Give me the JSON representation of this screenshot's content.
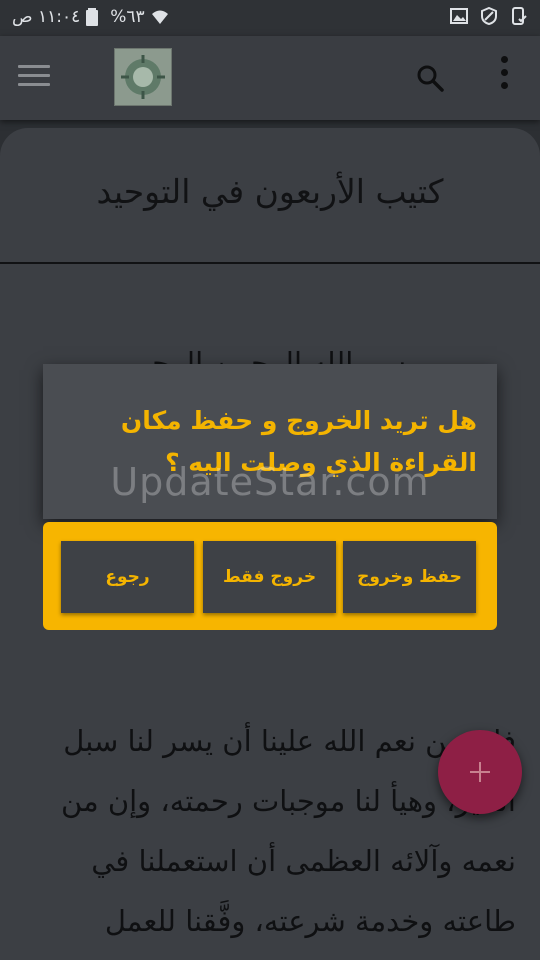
{
  "status_bar": {
    "time": "١١:٠٤ ص",
    "battery": "%٦٣"
  },
  "app_bar": {
    "logo_icon": "book-logo-icon",
    "search_icon": "search-icon",
    "menu_icon": "hamburger-menu-icon",
    "overflow_icon": "more-vert-icon"
  },
  "content": {
    "title": "كتيب الأربعون في التوحيد",
    "basmala": "بسم الله الرحمن الرحيم",
    "paragraph": "فإن من نعم الله علينا أن يسر لنا سبل الخير، وهيأ لنا موجبات رحمته، وإن من نعمه وآلائه العظمى أن استعملنا في طاعته وخدمة شرعته، وفَّقنا للعمل"
  },
  "dialog": {
    "message": "هل تريد الخروج و حفظ مكان القراءة الذي وصلت اليه ؟",
    "buttons": {
      "save_exit": "حفظ وخروج",
      "exit_only": "خروج فقط",
      "back": "رجوع"
    },
    "accent_color": "#f4b400"
  },
  "watermark": "UpdateStar.com",
  "fab": {
    "icon": "plus-icon",
    "color": "#8e1f45"
  }
}
